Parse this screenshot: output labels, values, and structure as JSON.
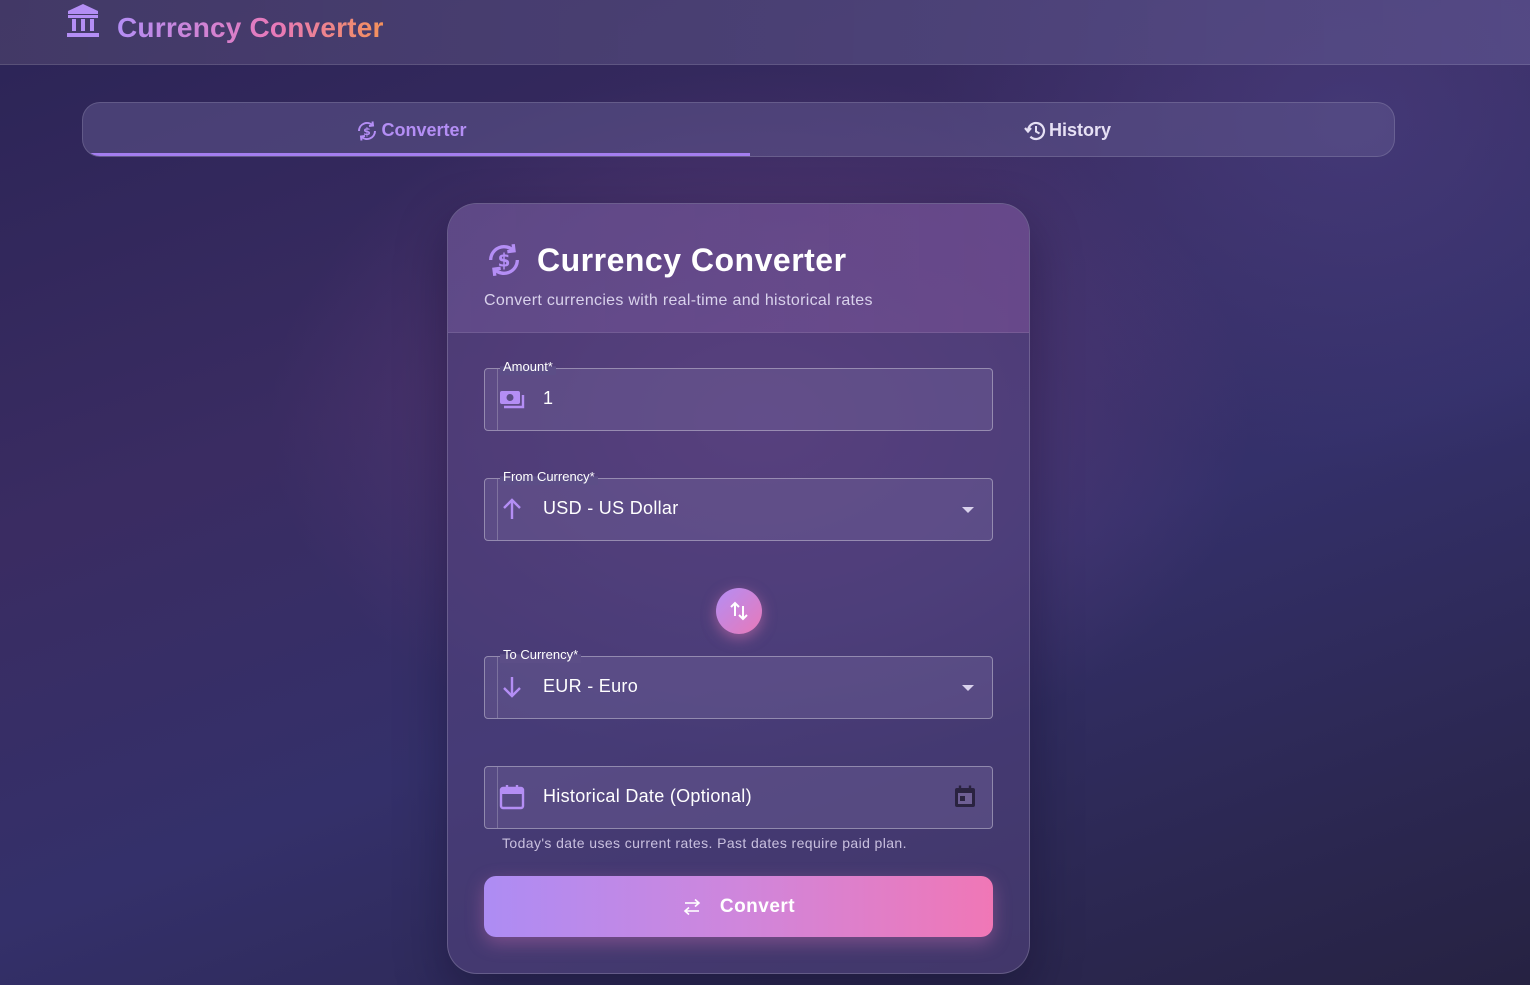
{
  "app": {
    "title": "Currency Converter",
    "brand_icon": "bank-icon"
  },
  "tabs": [
    {
      "label": "Converter",
      "icon": "currency-exchange-icon",
      "active": true
    },
    {
      "label": "History",
      "icon": "history-icon",
      "active": false
    }
  ],
  "card": {
    "title": "Currency Converter",
    "subtitle": "Convert currencies with real-time and historical rates",
    "icon": "currency-exchange-icon"
  },
  "form": {
    "amount": {
      "label": "Amount*",
      "value": "1",
      "icon": "cash-icon"
    },
    "from_currency": {
      "label": "From Currency*",
      "value": "USD - US Dollar",
      "icon": "arrow-up-icon"
    },
    "swap": {
      "icon": "swap-vertical-icon"
    },
    "to_currency": {
      "label": "To Currency*",
      "value": "EUR - Euro",
      "icon": "arrow-down-icon"
    },
    "date": {
      "placeholder": "Historical Date (Optional)",
      "icon": "calendar-icon",
      "helper": "Today's date uses current rates. Past dates require paid plan."
    },
    "convert_button": {
      "label": "Convert",
      "icon": "swap-horizontal-icon"
    }
  },
  "colors": {
    "accent": "#b48ef5",
    "pink": "#e879b8",
    "orange": "#f4915a"
  }
}
